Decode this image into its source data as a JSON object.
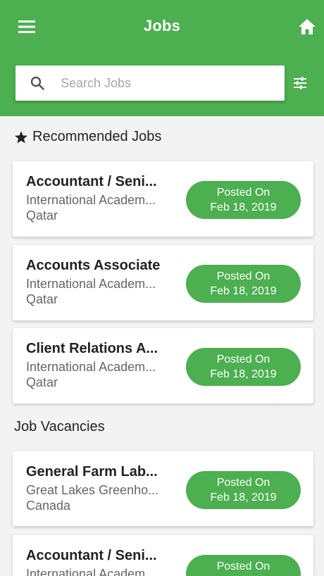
{
  "header": {
    "title": "Jobs",
    "background": "#4caf50",
    "menu_icon": "hamburger-menu-icon",
    "home_icon": "home-icon",
    "filter_icon": "tune-sliders-icon"
  },
  "search": {
    "placeholder": "Search Jobs",
    "value": ""
  },
  "sections": {
    "recommended": {
      "title": "Recommended Jobs",
      "icon": "star-icon",
      "jobs": [
        {
          "title": "Accountant / Seni...",
          "company": "International Academ...",
          "location": "Qatar",
          "posted_label": "Posted On",
          "posted_date": "Feb 18, 2019"
        },
        {
          "title": "Accounts Associate",
          "company": "International Academ...",
          "location": "Qatar",
          "posted_label": "Posted On",
          "posted_date": "Feb 18, 2019"
        },
        {
          "title": "Client Relations A...",
          "company": "International Academ...",
          "location": "Qatar",
          "posted_label": "Posted On",
          "posted_date": "Feb 18, 2019"
        }
      ]
    },
    "vacancies": {
      "title": "Job Vacancies",
      "jobs": [
        {
          "title": "General Farm Lab...",
          "company": "Great Lakes Greenho...",
          "location": "Canada",
          "posted_label": "Posted On",
          "posted_date": "Feb 18, 2019"
        },
        {
          "title": "Accountant / Seni...",
          "company": "International Academ...",
          "location": "",
          "posted_label": "Posted On",
          "posted_date": ""
        }
      ]
    }
  }
}
